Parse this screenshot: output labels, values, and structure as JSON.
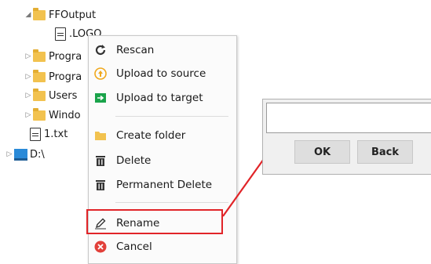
{
  "tree": {
    "items": [
      {
        "label": "FFOutput"
      },
      {
        "label": ".LOGO"
      },
      {
        "label": "Progra"
      },
      {
        "label": "Progra"
      },
      {
        "label": "Users"
      },
      {
        "label": "Windo"
      },
      {
        "label": "1.txt"
      },
      {
        "label": "D:\\"
      }
    ]
  },
  "context_menu": {
    "items": [
      {
        "label": "Rescan",
        "icon": "refresh-icon"
      },
      {
        "label": "Upload to source",
        "icon": "upload-circle-icon"
      },
      {
        "label": "Upload to target",
        "icon": "upload-target-icon"
      },
      {
        "label": "Create folder",
        "icon": "folder-icon"
      },
      {
        "label": "Delete",
        "icon": "trash-icon"
      },
      {
        "label": "Permanent Delete",
        "icon": "trash-icon"
      },
      {
        "label": "Rename",
        "icon": "pencil-icon"
      },
      {
        "label": "Cancel",
        "icon": "cancel-icon"
      }
    ]
  },
  "rename_dialog": {
    "input_value": "",
    "ok_label": "OK",
    "back_label": "Back"
  },
  "colors": {
    "highlight": "#e12428",
    "folder": "#f2c24f"
  }
}
